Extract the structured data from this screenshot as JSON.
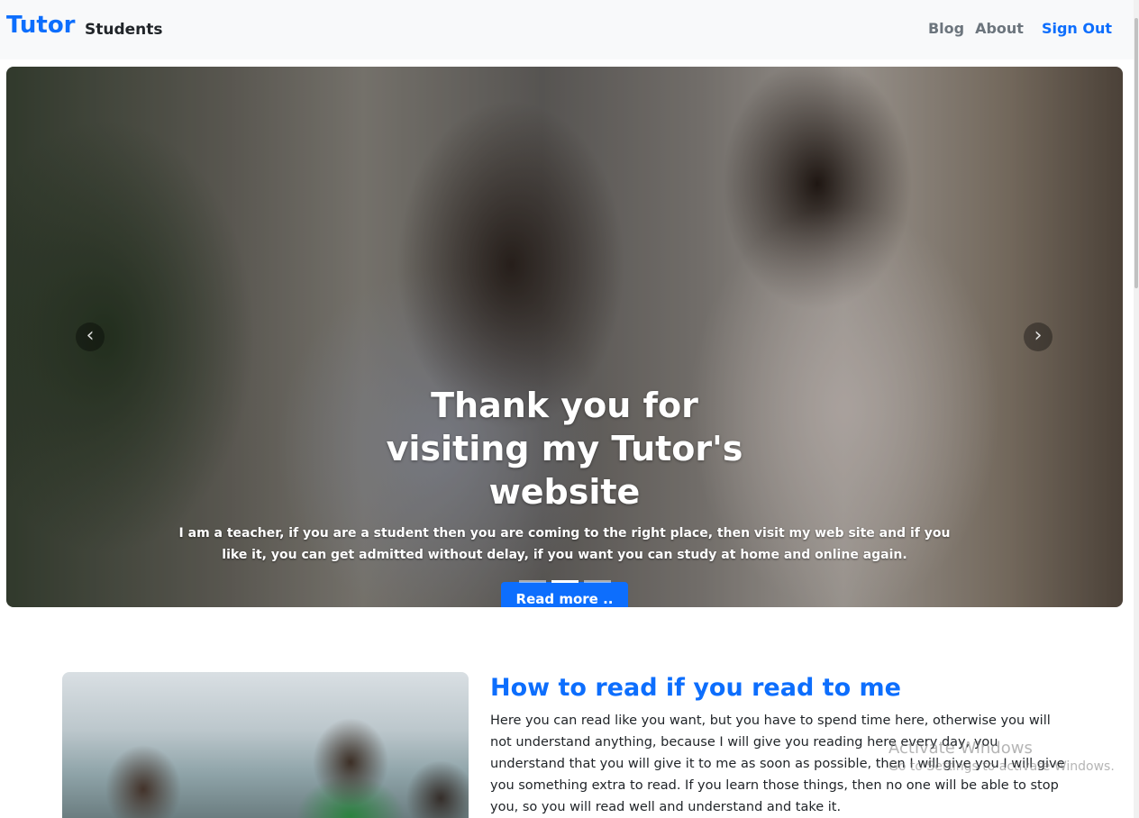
{
  "navbar": {
    "brand": "Tutor",
    "students": "Students",
    "links": [
      "Blog",
      "About"
    ],
    "sign_out": "Sign Out"
  },
  "carousel": {
    "title": "Thank you for visiting my Tutor's website",
    "description": "I am a teacher, if you are a student then you are coming to the right place, then visit my web site and if you like it, you can get admitted without delay, if you want you can study at home and online again.",
    "button": "Read more ..",
    "prev_icon": "chevron-left-icon",
    "next_icon": "chevron-right-icon",
    "slide_count": 3,
    "active_slide": 2
  },
  "feature": {
    "title": "How to read if you read to me",
    "text": "Here you can read like you want, but you have to spend time here, otherwise you will not understand anything, because I will give you reading here every day, you understand that you will give it to me as soon as possible, then I will give you I will give you something extra to read. If you learn those things, then no one will be able to stop you, so you will read well and understand and take it."
  },
  "watermark": {
    "line1": "Activate Windows",
    "line2": "Go to Settings to activate Windows."
  },
  "colors": {
    "primary": "#0d6efd",
    "navbar_bg": "#f8f9fa"
  }
}
